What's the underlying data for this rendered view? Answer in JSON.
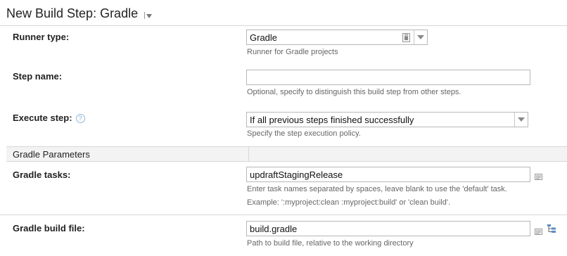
{
  "page": {
    "title": "New Build Step: Gradle"
  },
  "runner_type": {
    "label": "Runner type:",
    "value": "Gradle",
    "help": "Runner for Gradle projects"
  },
  "step_name": {
    "label": "Step name:",
    "value": "",
    "help": "Optional, specify to distinguish this build step from other steps."
  },
  "execute_step": {
    "label": "Execute step:",
    "help_icon": "?",
    "value": "If all previous steps finished successfully",
    "help": "Specify the step execution policy."
  },
  "section": {
    "title": "Gradle Parameters"
  },
  "gradle_tasks": {
    "label": "Gradle tasks:",
    "value": "updraftStagingRelease",
    "help_line1": "Enter task names separated by spaces, leave blank to use the 'default' task.",
    "help_line2": "Example: ':myproject:clean :myproject:build' or 'clean build'."
  },
  "build_file": {
    "label": "Gradle build file:",
    "value": "build.gradle",
    "help": "Path to build file, relative to the working directory"
  },
  "icons": {
    "runner_lock": "lock-icon",
    "text_editor": "edit-text-icon",
    "tree_chooser": "tree-icon"
  }
}
